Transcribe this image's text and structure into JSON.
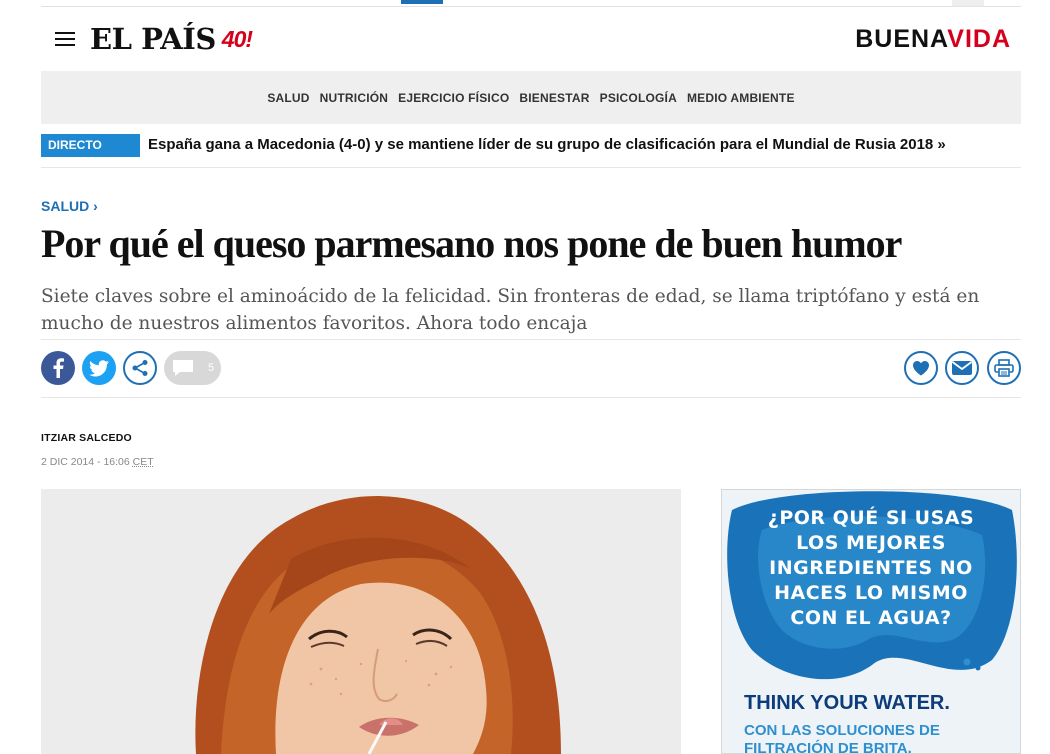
{
  "header": {
    "logo_text": "EL PAÍS",
    "logo_badge": "40!",
    "brand_part1": "BUENA",
    "brand_part2": "VIDA"
  },
  "nav": {
    "items": [
      "SALUD",
      "NUTRICIÓN",
      "EJERCICIO FÍSICO",
      "BIENESTAR",
      "PSICOLOGÍA",
      "MEDIO AMBIENTE"
    ]
  },
  "ticker": {
    "tag": "DIRECTO",
    "text": "España gana a Macedonia (4-0) y se mantiene líder de su grupo de clasificación para el Mundial de Rusia 2018  »"
  },
  "article": {
    "section": "SALUD ›",
    "headline": "Por qué el queso parmesano nos pone de buen humor",
    "subtitle": "Siete claves sobre el aminoácido de la felicidad. Sin fronteras de edad, se llama triptófano y está en mucho de nuestros alimentos favoritos. Ahora todo encaja",
    "author": "ITZIAR SALCEDO",
    "date": "2 DIC 2014 - 16:06",
    "timezone": "CET"
  },
  "share": {
    "comment_count": "5"
  },
  "ad": {
    "headline_lines": [
      "¿POR QUÉ SI USAS",
      "LOS MEJORES",
      "INGREDIENTES NO",
      "HACES LO MISMO",
      "CON EL AGUA?"
    ],
    "tagline": "THINK YOUR WATER.",
    "sub_lines": [
      "CON LAS SOLUCIONES DE",
      "FILTRACIÓN DE BRITA."
    ]
  },
  "colors": {
    "accent_blue": "#1e6fb5",
    "ticker_blue": "#1e88d2",
    "brand_red": "#d5001c",
    "facebook": "#3b5998",
    "twitter": "#1da1f2"
  }
}
